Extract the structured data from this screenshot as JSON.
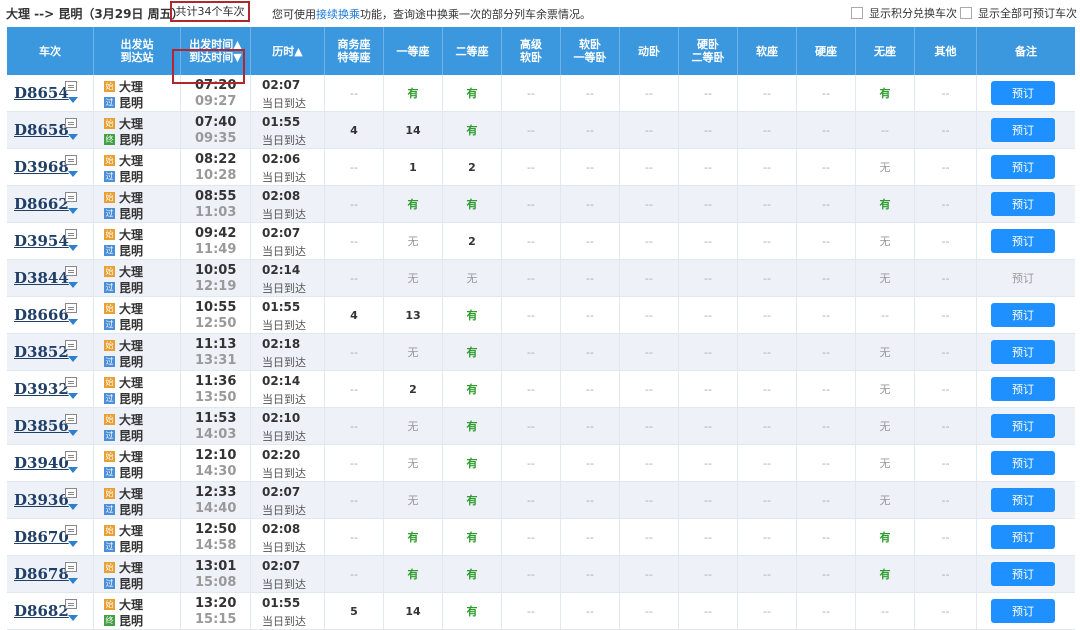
{
  "topbar": {
    "route": "大理 --> 昆明（3月29日  周五）",
    "count_label": "共计34个车次",
    "hint_before": "您可使用",
    "hint_link": "接续换乘",
    "hint_after": "功能，查询途中换乘一次的部分列车余票情况。",
    "option1": "显示积分兑换车次",
    "option2": "显示全部可预订车次"
  },
  "headers": {
    "train": "车次",
    "stations_top": "出发站",
    "stations_bottom": "到达站",
    "times_top": "出发时间▲",
    "times_bottom": "到达时间▼",
    "duration": "历时▲",
    "seats": [
      "商务座\n特等座",
      "一等座",
      "二等座",
      "高级\n软卧",
      "软卧\n一等卧",
      "动卧",
      "硬卧\n二等卧",
      "软座",
      "硬座",
      "无座",
      "其他"
    ],
    "remark": "备注"
  },
  "colors": {
    "header_bg": "#3b97de",
    "button": "#1e90ff",
    "available": "#2e9c2e",
    "highlight_box": "#b0282d"
  },
  "rows": [
    {
      "train": "D8654",
      "from": "大理",
      "to": "昆明",
      "to_badge": "过",
      "dep": "07:20",
      "arr": "09:27",
      "dur": "02:07",
      "arrive_day": "当日到达",
      "seats": [
        "--",
        "有",
        "有",
        "--",
        "--",
        "--",
        "--",
        "--",
        "--",
        "有",
        "--"
      ],
      "book": "预订",
      "bookable": true
    },
    {
      "train": "D8658",
      "from": "大理",
      "to": "昆明",
      "to_badge": "终",
      "dep": "07:40",
      "arr": "09:35",
      "dur": "01:55",
      "arrive_day": "当日到达",
      "seats": [
        "4",
        "14",
        "有",
        "--",
        "--",
        "--",
        "--",
        "--",
        "--",
        "--",
        "--"
      ],
      "book": "预订",
      "bookable": true
    },
    {
      "train": "D3968",
      "from": "大理",
      "to": "昆明",
      "to_badge": "过",
      "dep": "08:22",
      "arr": "10:28",
      "dur": "02:06",
      "arrive_day": "当日到达",
      "seats": [
        "--",
        "1",
        "2",
        "--",
        "--",
        "--",
        "--",
        "--",
        "--",
        "无",
        "--"
      ],
      "book": "预订",
      "bookable": true
    },
    {
      "train": "D8662",
      "from": "大理",
      "to": "昆明",
      "to_badge": "过",
      "dep": "08:55",
      "arr": "11:03",
      "dur": "02:08",
      "arrive_day": "当日到达",
      "seats": [
        "--",
        "有",
        "有",
        "--",
        "--",
        "--",
        "--",
        "--",
        "--",
        "有",
        "--"
      ],
      "book": "预订",
      "bookable": true
    },
    {
      "train": "D3954",
      "from": "大理",
      "to": "昆明",
      "to_badge": "过",
      "dep": "09:42",
      "arr": "11:49",
      "dur": "02:07",
      "arrive_day": "当日到达",
      "seats": [
        "--",
        "无",
        "2",
        "--",
        "--",
        "--",
        "--",
        "--",
        "--",
        "无",
        "--"
      ],
      "book": "预订",
      "bookable": true
    },
    {
      "train": "D3844",
      "from": "大理",
      "to": "昆明",
      "to_badge": "过",
      "dep": "10:05",
      "arr": "12:19",
      "dur": "02:14",
      "arrive_day": "当日到达",
      "seats": [
        "--",
        "无",
        "无",
        "--",
        "--",
        "--",
        "--",
        "--",
        "--",
        "无",
        "--"
      ],
      "book": "预订",
      "bookable": false
    },
    {
      "train": "D8666",
      "from": "大理",
      "to": "昆明",
      "to_badge": "过",
      "dep": "10:55",
      "arr": "12:50",
      "dur": "01:55",
      "arrive_day": "当日到达",
      "seats": [
        "4",
        "13",
        "有",
        "--",
        "--",
        "--",
        "--",
        "--",
        "--",
        "--",
        "--"
      ],
      "book": "预订",
      "bookable": true
    },
    {
      "train": "D3852",
      "from": "大理",
      "to": "昆明",
      "to_badge": "过",
      "dep": "11:13",
      "arr": "13:31",
      "dur": "02:18",
      "arrive_day": "当日到达",
      "seats": [
        "--",
        "无",
        "有",
        "--",
        "--",
        "--",
        "--",
        "--",
        "--",
        "无",
        "--"
      ],
      "book": "预订",
      "bookable": true
    },
    {
      "train": "D3932",
      "from": "大理",
      "to": "昆明",
      "to_badge": "过",
      "dep": "11:36",
      "arr": "13:50",
      "dur": "02:14",
      "arrive_day": "当日到达",
      "seats": [
        "--",
        "2",
        "有",
        "--",
        "--",
        "--",
        "--",
        "--",
        "--",
        "无",
        "--"
      ],
      "book": "预订",
      "bookable": true
    },
    {
      "train": "D3856",
      "from": "大理",
      "to": "昆明",
      "to_badge": "过",
      "dep": "11:53",
      "arr": "14:03",
      "dur": "02:10",
      "arrive_day": "当日到达",
      "seats": [
        "--",
        "无",
        "有",
        "--",
        "--",
        "--",
        "--",
        "--",
        "--",
        "无",
        "--"
      ],
      "book": "预订",
      "bookable": true
    },
    {
      "train": "D3940",
      "from": "大理",
      "to": "昆明",
      "to_badge": "过",
      "dep": "12:10",
      "arr": "14:30",
      "dur": "02:20",
      "arrive_day": "当日到达",
      "seats": [
        "--",
        "无",
        "有",
        "--",
        "--",
        "--",
        "--",
        "--",
        "--",
        "无",
        "--"
      ],
      "book": "预订",
      "bookable": true
    },
    {
      "train": "D3936",
      "from": "大理",
      "to": "昆明",
      "to_badge": "过",
      "dep": "12:33",
      "arr": "14:40",
      "dur": "02:07",
      "arrive_day": "当日到达",
      "seats": [
        "--",
        "无",
        "有",
        "--",
        "--",
        "--",
        "--",
        "--",
        "--",
        "无",
        "--"
      ],
      "book": "预订",
      "bookable": true
    },
    {
      "train": "D8670",
      "from": "大理",
      "to": "昆明",
      "to_badge": "过",
      "dep": "12:50",
      "arr": "14:58",
      "dur": "02:08",
      "arrive_day": "当日到达",
      "seats": [
        "--",
        "有",
        "有",
        "--",
        "--",
        "--",
        "--",
        "--",
        "--",
        "有",
        "--"
      ],
      "book": "预订",
      "bookable": true
    },
    {
      "train": "D8678",
      "from": "大理",
      "to": "昆明",
      "to_badge": "过",
      "dep": "13:01",
      "arr": "15:08",
      "dur": "02:07",
      "arrive_day": "当日到达",
      "seats": [
        "--",
        "有",
        "有",
        "--",
        "--",
        "--",
        "--",
        "--",
        "--",
        "有",
        "--"
      ],
      "book": "预订",
      "bookable": true
    },
    {
      "train": "D8682",
      "from": "大理",
      "to": "昆明",
      "to_badge": "终",
      "dep": "13:20",
      "arr": "15:15",
      "dur": "01:55",
      "arrive_day": "当日到达",
      "seats": [
        "5",
        "14",
        "有",
        "--",
        "--",
        "--",
        "--",
        "--",
        "--",
        "--",
        "--"
      ],
      "book": "预订",
      "bookable": true
    }
  ],
  "badges": {
    "start": "始",
    "pass": "过",
    "end": "终"
  }
}
